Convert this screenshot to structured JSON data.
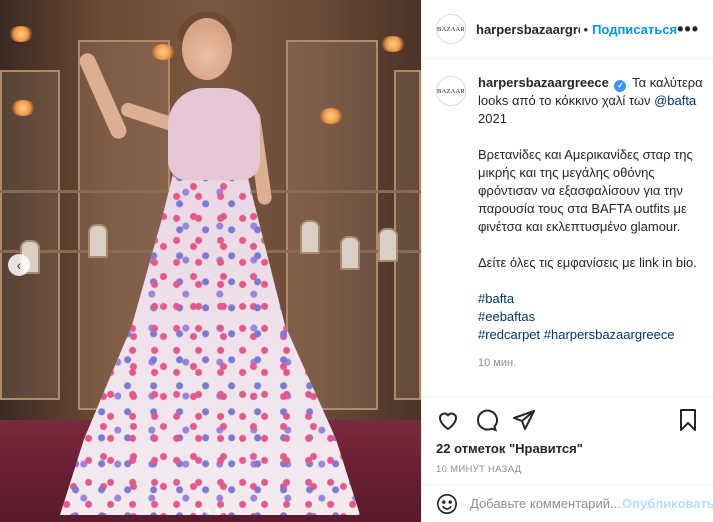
{
  "post": {
    "photo_alt_icon": "photo",
    "carousel": {
      "prev_icon": "chevron-left-icon",
      "dot_count": 3,
      "active_dot": 0
    }
  },
  "header": {
    "avatar_text": "BAZAAR",
    "username": "harpersbazaargreece",
    "separator": "•",
    "follow_label": "Подписаться",
    "more_label": "•••"
  },
  "caption": {
    "avatar_text": "BAZAAR",
    "username": "harpersbazaargreece",
    "verified_glyph": "✓",
    "line1": "Τα καλύτερα looks από το κόκκινο χαλί των",
    "mention": "@bafta",
    "line1_end": "2021",
    "para2": "Βρετανίδες και Αμερικανίδες σταρ της μικρής και της μεγάλης οθόνης φρόντισαν να εξασφαλίσουν για την παρουσία τους στα BAFTA outfits με φινέτσα και εκλεπτυσμένο glamour.",
    "para3": "Δείτε όλες τις εμφανίσεις με link in bio.",
    "hashtags": [
      "#bafta",
      "#eebaftas",
      "#redcarpet",
      "#harpersbazaargreece"
    ],
    "time": "10 мин."
  },
  "actions": {
    "icons": [
      "heart-icon",
      "comment-icon",
      "share-icon",
      "bookmark-icon"
    ],
    "likes": "22 отметок \"Нравится\"",
    "posted_ago": "10 МИНУТ НАЗАД"
  },
  "comment": {
    "placeholder": "Добавьте комментарий...",
    "publish_label": "Опубликовать"
  },
  "colors": {
    "accent": "#0095f6",
    "link": "#00376b",
    "muted": "#8e8e8e",
    "publish_disabled": "#b2dffc"
  }
}
